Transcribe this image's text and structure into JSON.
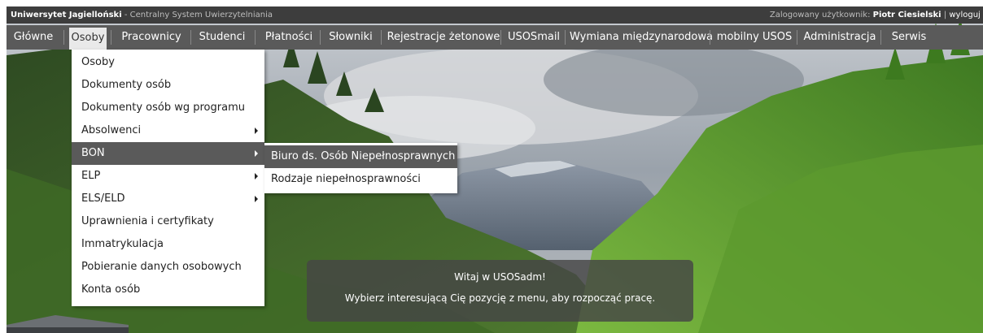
{
  "topbar": {
    "university": "Uniwersytet Jagielloński",
    "system_name": "- Centralny System Uwierzytelniania",
    "logged_in_label": "Zalogowany użytkownik:",
    "user_name": "Piotr Ciesielski",
    "separator": "|",
    "logout": "wyloguj si"
  },
  "menu": {
    "items": [
      {
        "label": "Główne"
      },
      {
        "label": "Osoby"
      },
      {
        "label": "Pracownicy"
      },
      {
        "label": "Studenci"
      },
      {
        "label": "Płatności"
      },
      {
        "label": "Słowniki"
      },
      {
        "label": "Rejestracje żetonowe"
      },
      {
        "label": "USOSmail"
      },
      {
        "label": "Wymiana międzynarodowa"
      },
      {
        "label": "mobilny USOS"
      },
      {
        "label": "Administracja"
      },
      {
        "label": "Serwis"
      }
    ],
    "active": "Osoby"
  },
  "dropdown": {
    "items": [
      {
        "label": "Osoby"
      },
      {
        "label": "Dokumenty osób"
      },
      {
        "label": "Dokumenty osób wg programu"
      },
      {
        "label": "Absolwenci",
        "submenu": true
      },
      {
        "label": "BON",
        "submenu": true
      },
      {
        "label": "ELP",
        "submenu": true
      },
      {
        "label": "ELS/ELD",
        "submenu": true
      },
      {
        "label": "Uprawnienia i certyfikaty"
      },
      {
        "label": "Immatrykulacja"
      },
      {
        "label": "Pobieranie danych osobowych"
      },
      {
        "label": "Konta osób"
      }
    ],
    "highlighted": "BON"
  },
  "submenu": {
    "items": [
      {
        "label": "Biuro ds. Osób Niepełnosprawnych"
      },
      {
        "label": "Rodzaje niepełnosprawności"
      }
    ],
    "highlighted": "Biuro ds. Osób Niepełnosprawnych"
  },
  "welcome": {
    "title": "Witaj w USOSadm!",
    "message": "Wybierz interesującą Cię pozycję z menu, aby rozpocząć pracę."
  },
  "colors": {
    "topbar": "#3d3d3d",
    "menubar": "#5a5a5a",
    "highlight": "#5a5a5a",
    "active_tab": "#e9e9e9"
  }
}
